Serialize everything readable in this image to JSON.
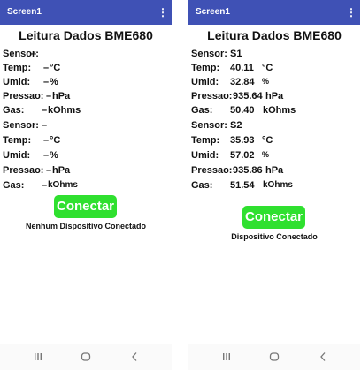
{
  "screens": [
    {
      "app_bar": {
        "title": "Screen1",
        "menu_icon": "more-vert-icon"
      },
      "heading": "Leitura Dados BME680",
      "rows": [
        {
          "label": "Sensor:",
          "value": "–",
          "unit": ""
        },
        {
          "label": "Temp:",
          "value": "–",
          "unit": "°C"
        },
        {
          "label": "Umid:",
          "value": "–",
          "unit": "%"
        },
        {
          "label": "Pressao:",
          "value": "–",
          "unit": "hPa"
        },
        {
          "label": "Gas:",
          "value": "–",
          "unit": "kOhms"
        },
        {
          "label": "Sensor:",
          "value": "–",
          "unit": ""
        },
        {
          "label": "Temp:",
          "value": "–",
          "unit": "°C"
        },
        {
          "label": "Umid:",
          "value": "–",
          "unit": "%"
        },
        {
          "label": "Pressao:",
          "value": "–",
          "unit": "hPa"
        },
        {
          "label": "Gas:",
          "value": "–",
          "unit": "kOhms"
        }
      ],
      "button_label": "Conectar",
      "status": "Nenhum Dispositivo Conectado"
    },
    {
      "app_bar": {
        "title": "Screen1",
        "menu_icon": "more-vert-icon"
      },
      "heading": "Leitura Dados BME680",
      "rows": [
        {
          "label": "Sensor:",
          "value": "S1",
          "unit": ""
        },
        {
          "label": "Temp:",
          "value": "40.11",
          "unit": "°C"
        },
        {
          "label": "Umid:",
          "value": "32.84",
          "unit": "%"
        },
        {
          "label": "Pressao:",
          "value": "935.64",
          "unit": "hPa"
        },
        {
          "label": "Gas:",
          "value": "50.40",
          "unit": "kOhms"
        },
        {
          "label": "Sensor:",
          "value": "S2",
          "unit": ""
        },
        {
          "label": "Temp:",
          "value": "35.93",
          "unit": "°C"
        },
        {
          "label": "Umid:",
          "value": "57.02",
          "unit": "%"
        },
        {
          "label": "Pressao:",
          "value": "935.86",
          "unit": "hPa"
        },
        {
          "label": "Gas:",
          "value": "51.54",
          "unit": "kOhms"
        }
      ],
      "button_label": "Conectar",
      "status": "Dispositivo Conectado"
    }
  ],
  "theme": {
    "app_bar_color": "#3f51b5",
    "button_color": "#2fe02f"
  },
  "nav_icons": [
    "recent-apps-icon",
    "home-icon",
    "back-icon"
  ]
}
